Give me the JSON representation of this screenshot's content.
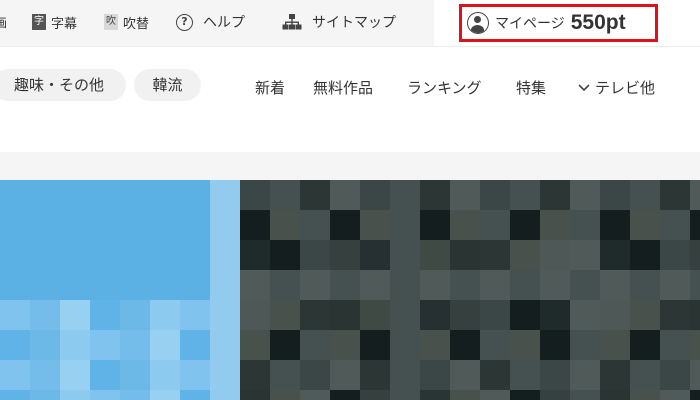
{
  "topbar": {
    "cut_char": "画",
    "subtitle_badge": "字",
    "subtitle_label": "字幕",
    "dub_badge": "吹",
    "dub_label": "吹替",
    "help_label": "ヘルプ",
    "sitemap_label": "サイトマップ",
    "mypage_label": "マイページ",
    "points": "550pt"
  },
  "nav": {
    "pills": [
      "趣味・その他",
      "韓流"
    ],
    "links": [
      "新着",
      "無料作品",
      "ランキング",
      "特集"
    ],
    "dropdown_label": "テレビ他"
  },
  "banner": {
    "left_color": "#5cb1e4",
    "strip_color": "#92cbed"
  },
  "colors": {
    "highlight": "#e0111b",
    "topbar_bg": "#f5f5f5"
  }
}
